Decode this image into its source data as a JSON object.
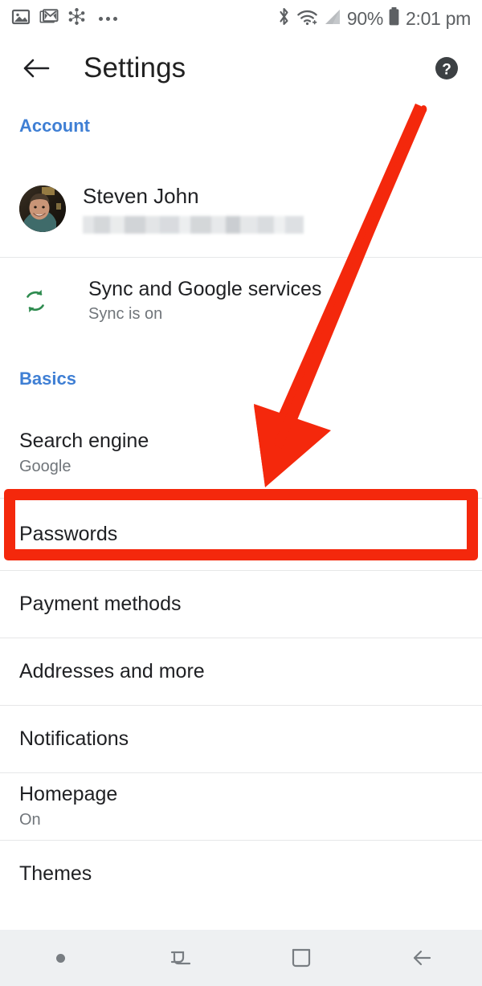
{
  "status_bar": {
    "left_icons": [
      "photo-icon",
      "gmail-icon",
      "share-nodes-icon",
      "more-notifications-icon"
    ],
    "right_icons": [
      "bluetooth-icon",
      "wifi-icon",
      "cellular-signal-icon",
      "battery-icon"
    ],
    "battery_percent": "90%",
    "clock": "2:01 pm"
  },
  "app_bar": {
    "back_label": "back-arrow",
    "title": "Settings",
    "help_label": "?"
  },
  "sections": {
    "account": {
      "header": "Account",
      "profile": {
        "name": "Steven John",
        "email_redacted": true
      },
      "sync": {
        "title": "Sync and Google services",
        "subtitle": "Sync is on",
        "icon": "sync-icon",
        "icon_color": "#2e8b4f"
      }
    },
    "basics": {
      "header": "Basics",
      "items": [
        {
          "title": "Search engine",
          "subtitle": "Google",
          "highlighted": false
        },
        {
          "title": "Passwords",
          "subtitle": "",
          "highlighted": true
        },
        {
          "title": "Payment methods",
          "subtitle": "",
          "highlighted": false
        },
        {
          "title": "Addresses and more",
          "subtitle": "",
          "highlighted": false
        },
        {
          "title": "Notifications",
          "subtitle": "",
          "highlighted": false
        },
        {
          "title": "Homepage",
          "subtitle": "On",
          "highlighted": false
        },
        {
          "title": "Themes",
          "subtitle": "",
          "highlighted": false
        }
      ]
    }
  },
  "nav_bar": {
    "items": [
      "nav-dot",
      "recents-icon",
      "home-icon",
      "back-icon"
    ]
  },
  "annotation": {
    "color": "#f4280c",
    "arrow": "points to Passwords row",
    "highlight_target": "Passwords"
  },
  "colors": {
    "accent_blue": "#3f7fd4",
    "annotation_red": "#f4280c",
    "sync_green": "#2e8b4f",
    "primary_text": "#202124",
    "secondary_text": "#70757a",
    "navbar_bg": "#eef0f2"
  }
}
